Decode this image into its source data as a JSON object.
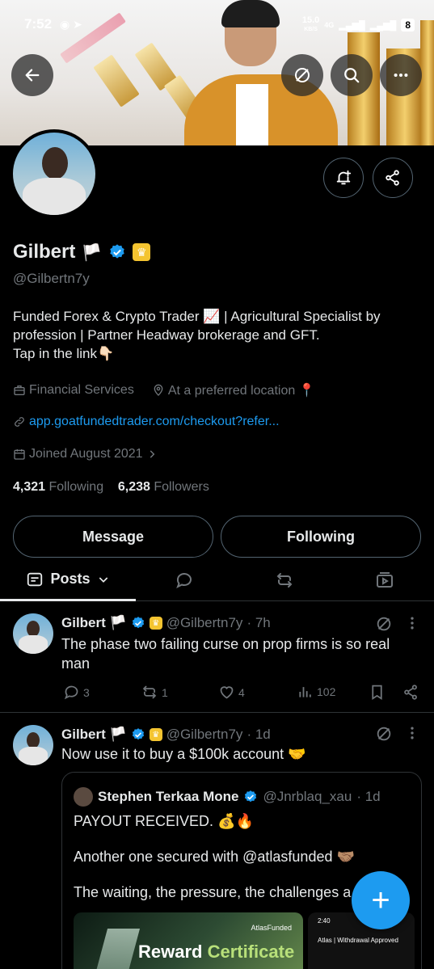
{
  "status_bar": {
    "time": "7:52",
    "speed": "15.0",
    "speed_unit": "KB/S",
    "network": "4G",
    "battery": "8"
  },
  "profile": {
    "name": "Gilbert",
    "name_flag": "🏳️",
    "handle": "@Gilbertn7y",
    "bio_lines": [
      "Funded Forex & Crypto Trader 📈 | Agricultural Specialist by",
      "profession | Partner Headway brokerage and GFT.",
      "Tap in the link👇🏻"
    ],
    "category": "Financial Services",
    "location": "At a preferred location 📍",
    "website": "app.goatfundedtrader.com/checkout?refer...",
    "joined": "Joined August 2021",
    "following_count": "4,321",
    "following_label": "Following",
    "followers_count": "6,238",
    "followers_label": "Followers"
  },
  "buttons": {
    "message": "Message",
    "following": "Following"
  },
  "tabs": {
    "posts": "Posts"
  },
  "posts": [
    {
      "name": "Gilbert 🏳️",
      "handle": "@Gilbertn7y",
      "time": "· 7h",
      "text_lines": [
        "The phase two failing curse on prop firms is so real",
        "man"
      ],
      "replies": "3",
      "reposts": "1",
      "likes": "4",
      "views": "102"
    },
    {
      "name": "Gilbert 🏳️",
      "handle": "@Gilbertn7y",
      "time": "· 1d",
      "text_lines": [
        "Now use it to buy a $100k account 🤝"
      ],
      "quote": {
        "name": "Stephen Terkaa Mone",
        "handle": "@Jnrblaq_xau",
        "time": "· 1d",
        "lines": [
          "PAYOUT RECEIVED. 💰🔥",
          "Another one secured with @atlasfunded 🤝🏽",
          "The waiting, the pressure, the challenges a"
        ],
        "certificate_title_a": "Reward ",
        "certificate_title_b": "Certificate",
        "certificate_brand": "AtlasFunded",
        "phone_time": "2:40",
        "phone_title": "Atlas | Withdrawal Approved"
      }
    }
  ],
  "fab": "+"
}
